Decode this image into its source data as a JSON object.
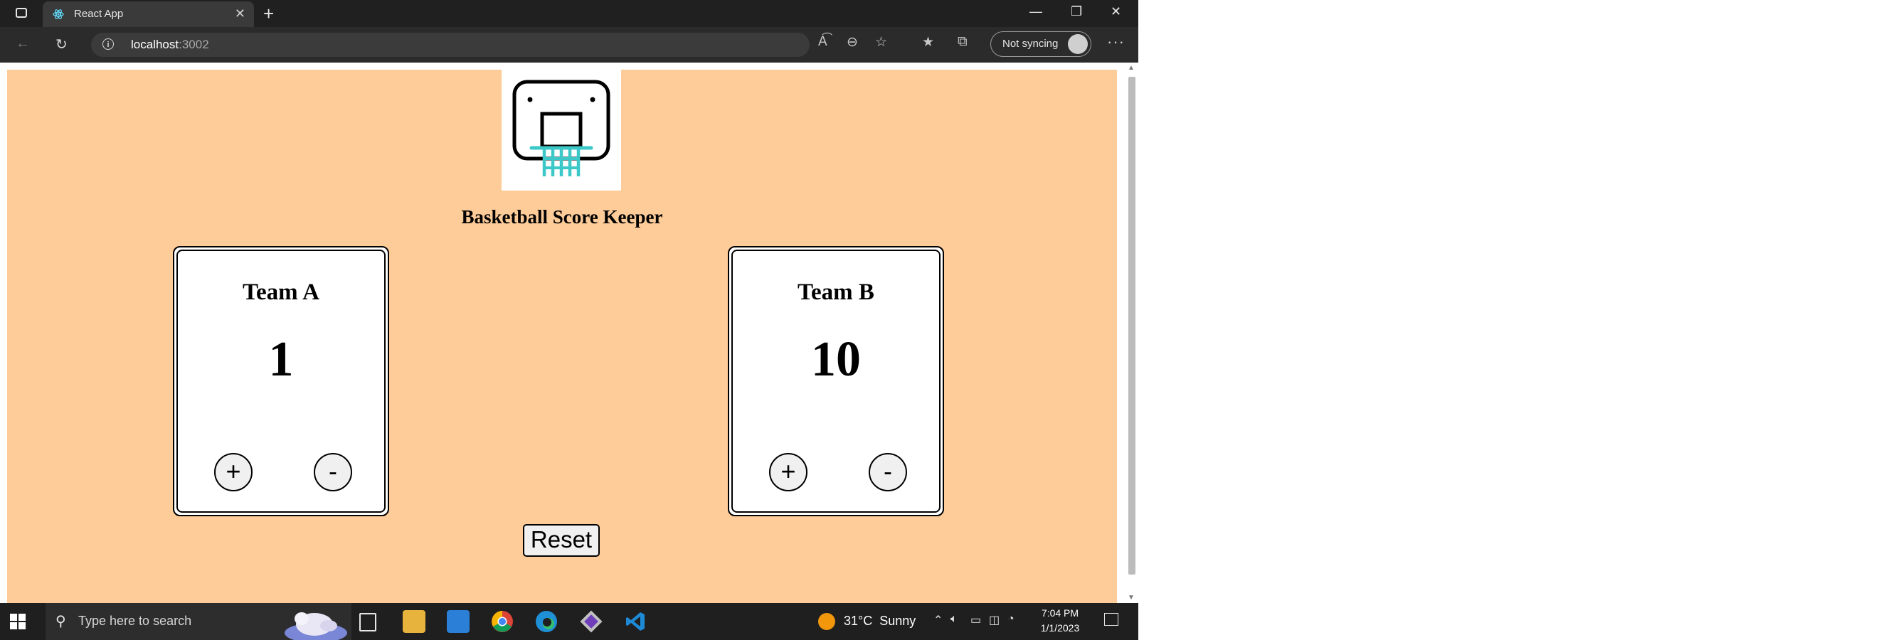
{
  "browser": {
    "tab_title": "React App",
    "url_host": "localhost",
    "url_port": ":3002",
    "sync_label": "Not syncing"
  },
  "app": {
    "title": "Basketball Score Keeper",
    "team_a": {
      "name": "Team A",
      "score": "1",
      "plus_label": "+",
      "minus_label": "-"
    },
    "team_b": {
      "name": "Team B",
      "score": "10",
      "plus_label": "+",
      "minus_label": "-"
    },
    "reset_label": "Reset",
    "background_color": "#fecc99",
    "hoop_net_color": "#3cc8c8"
  },
  "taskbar": {
    "search_placeholder": "Type here to search",
    "weather_temp": "31°C",
    "weather_desc": "Sunny",
    "time": "7:04 PM",
    "date": "1/1/2023"
  }
}
